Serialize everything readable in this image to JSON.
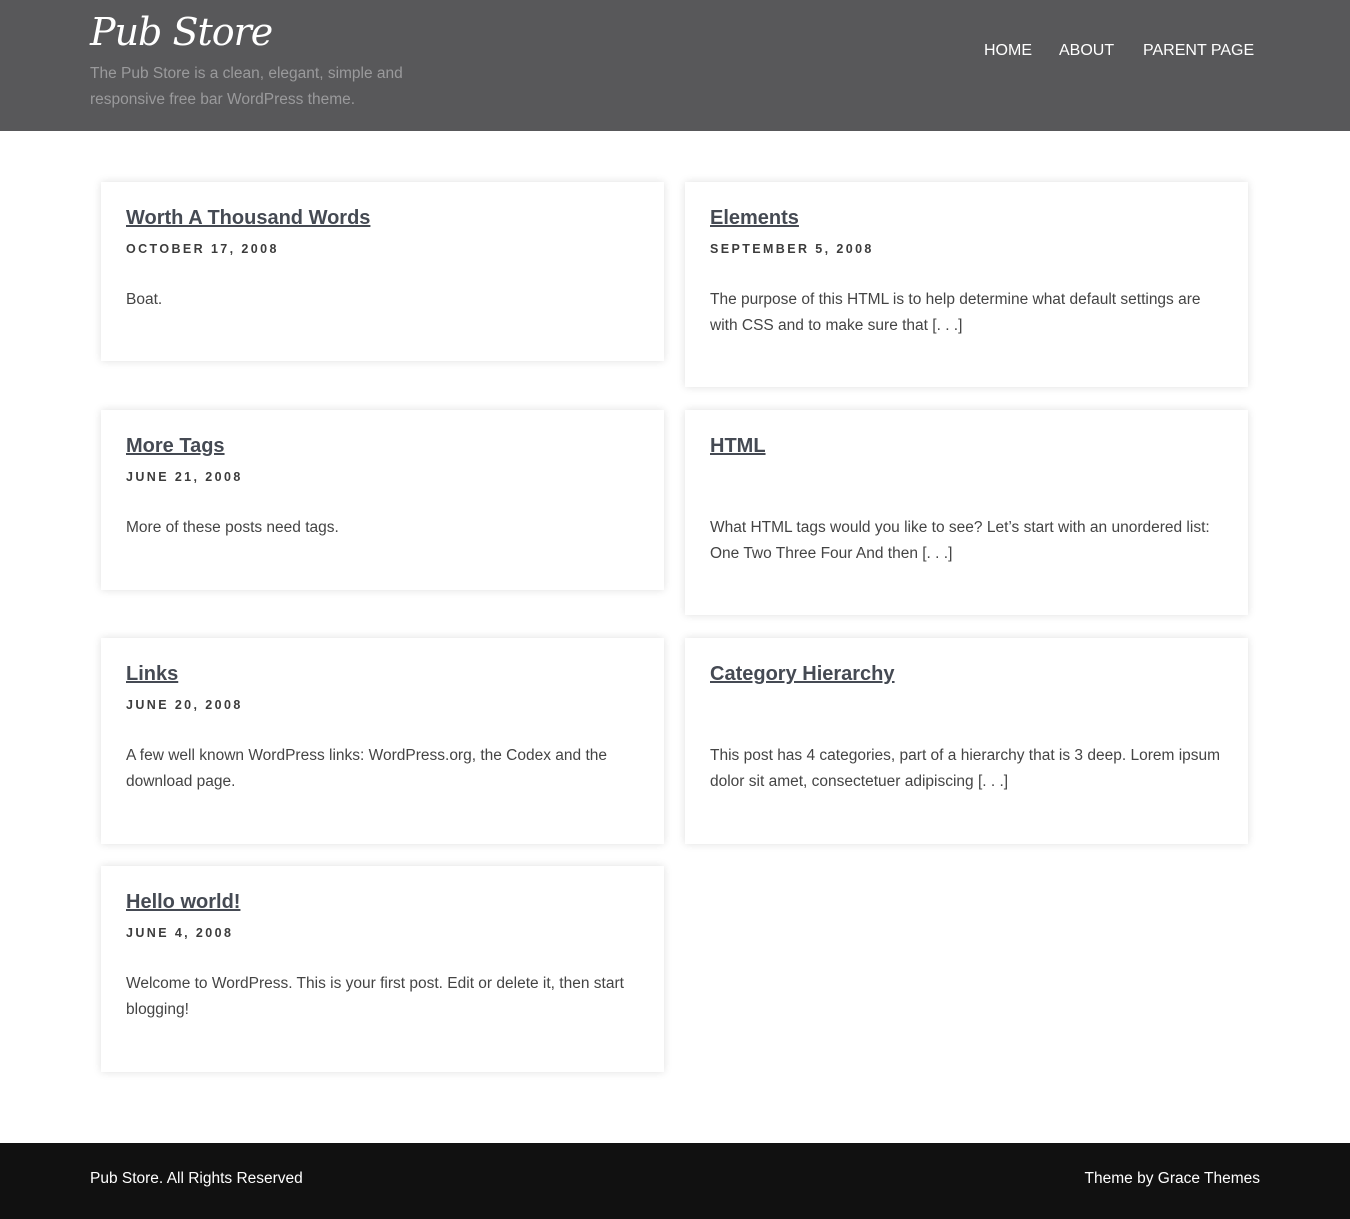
{
  "header": {
    "site_title": "Pub Store",
    "site_description": "The Pub Store is a clean, elegant, simple and responsive free bar WordPress theme.",
    "nav": [
      "HOME",
      "ABOUT",
      "PARENT PAGE"
    ]
  },
  "posts": [
    {
      "title": "Worth A Thousand Words",
      "date": "OCTOBER 17, 2008",
      "excerpt": "Boat."
    },
    {
      "title": "Elements",
      "date": "SEPTEMBER 5, 2008",
      "excerpt": "The purpose of this HTML is to help determine what default settings are with CSS and to make sure that [. . .]"
    },
    {
      "title": "More Tags",
      "date": "JUNE 21, 2008",
      "excerpt": "More of these posts need tags."
    },
    {
      "title": "HTML",
      "date": "",
      "excerpt": "What HTML tags would you like to see? Let’s start with an unordered list: One Two Three Four And then [. . .]"
    },
    {
      "title": "Links",
      "date": "JUNE 20, 2008",
      "excerpt": "A few well known WordPress links: WordPress.org, the Codex and the download page."
    },
    {
      "title": "Category Hierarchy",
      "date": "",
      "excerpt": "This post has 4 categories, part of a hierarchy that is 3 deep. Lorem ipsum dolor sit amet, consectetuer adipiscing [. . .]"
    },
    {
      "title": "Hello world!",
      "date": "JUNE 4, 2008",
      "excerpt": "Welcome to WordPress. This is your first post. Edit or delete it, then start blogging!"
    }
  ],
  "footer": {
    "copyright": "Pub Store. All Rights Reserved",
    "credit": "Theme by Grace Themes"
  },
  "colors": {
    "header_bg": "#58585a",
    "footer_bg": "#111111",
    "title_link": "#454a53"
  }
}
